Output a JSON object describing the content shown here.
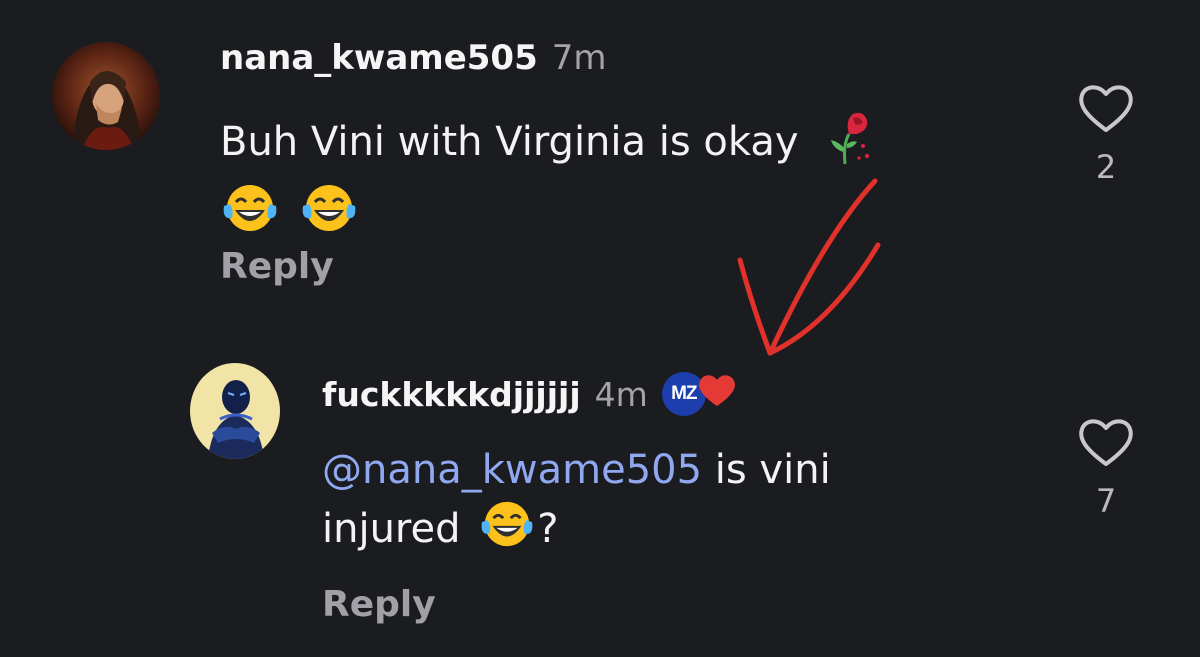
{
  "comments": [
    {
      "username": "nana_kwame505",
      "time": "7m",
      "text": "Buh Vini with Virginia is okay",
      "reply_label": "Reply",
      "likes": "2"
    },
    {
      "username": "fuckkkkkdjjjjjj",
      "time": "4m",
      "badge_text": "MZ",
      "mention": "@nana_kwame505",
      "text_after_mention": " is vini",
      "text_line2": "injured",
      "text_end": "?",
      "reply_label": "Reply",
      "likes": "7"
    }
  ],
  "icons": {
    "like": "heart-outline-icon",
    "wilted_rose": "wilted-rose-emoji",
    "laughing": "tears-of-joy-emoji",
    "badge_heart": "red-heart-icon"
  },
  "colors": {
    "background": "#1b1c20",
    "mention": "#8fa8f0",
    "annotation_arrow": "#e0312b",
    "badge": "#1d3fae"
  }
}
